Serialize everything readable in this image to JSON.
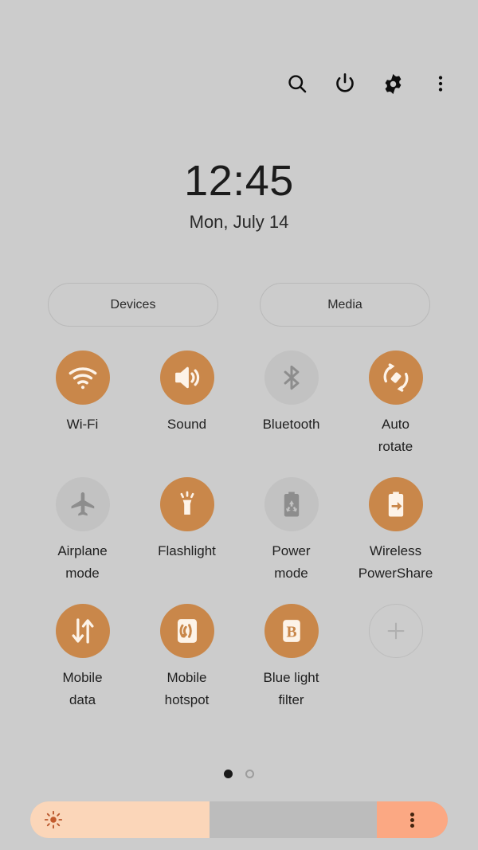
{
  "topbar": {
    "buttons": [
      {
        "name": "search-icon",
        "label": "Search"
      },
      {
        "name": "power-icon",
        "label": "Power off"
      },
      {
        "name": "gear-icon",
        "label": "Settings"
      },
      {
        "name": "overflow-menu-icon",
        "label": "More options"
      }
    ]
  },
  "clock": {
    "time": "12:45",
    "date": "Mon, July 14"
  },
  "pills": {
    "devices_label": "Devices",
    "media_label": "Media"
  },
  "toggles": [
    {
      "id": "wifi",
      "label": "Wi-Fi",
      "state": "on",
      "icon": "wifi-icon"
    },
    {
      "id": "sound",
      "label": "Sound",
      "state": "on",
      "icon": "sound-icon"
    },
    {
      "id": "bluetooth",
      "label": "Bluetooth",
      "state": "off",
      "icon": "bluetooth-icon"
    },
    {
      "id": "auto-rotate",
      "label": "Auto\nrotate",
      "state": "on",
      "icon": "auto-rotate-icon"
    },
    {
      "id": "airplane-mode",
      "label": "Airplane\nmode",
      "state": "off",
      "icon": "airplane-icon"
    },
    {
      "id": "flashlight",
      "label": "Flashlight",
      "state": "on",
      "icon": "flashlight-icon"
    },
    {
      "id": "power-mode",
      "label": "Power\nmode",
      "state": "off",
      "icon": "battery-recycle-icon"
    },
    {
      "id": "wireless-powershare",
      "label": "Wireless\nPowerShare",
      "state": "on",
      "icon": "battery-arrow-icon"
    },
    {
      "id": "mobile-data",
      "label": "Mobile\ndata",
      "state": "on",
      "icon": "data-arrows-icon"
    },
    {
      "id": "mobile-hotspot",
      "label": "Mobile\nhotspot",
      "state": "on",
      "icon": "hotspot-icon"
    },
    {
      "id": "blue-light-filter",
      "label": "Blue light\nfilter",
      "state": "on",
      "icon": "blue-light-b-icon"
    },
    {
      "id": "add-button",
      "label": "",
      "state": "add",
      "icon": "plus-icon"
    }
  ],
  "pagination": {
    "pages": 2,
    "active_page": 1
  },
  "brightness": {
    "value_percent": 43,
    "menu_start_percent": 83,
    "sun_icon": "sun-icon",
    "menu_icon": "overflow-menu-icon"
  },
  "colors": {
    "background": "#cccccc",
    "accent_on": "#c9874a",
    "toggle_off": "#c2c2c2",
    "brightness_fill": "#fbd6b9",
    "brightness_menu": "#fba883",
    "text": "#1f1f1f"
  }
}
